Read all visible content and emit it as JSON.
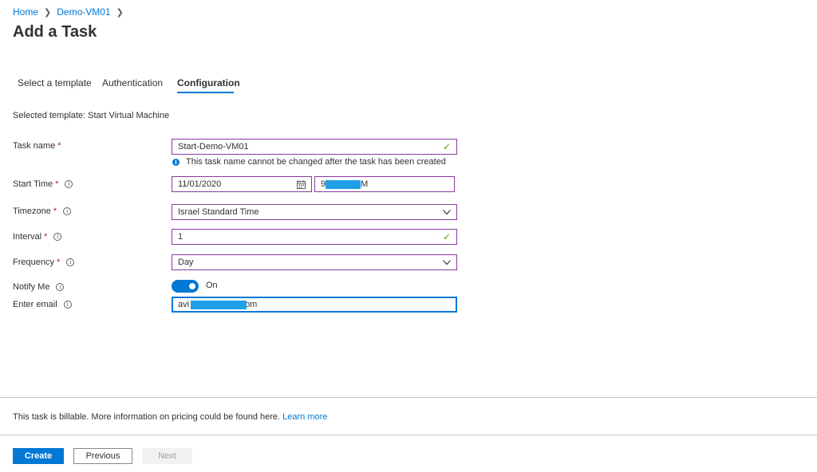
{
  "breadcrumb": {
    "home": "Home",
    "vm": "Demo-VM01"
  },
  "page_title": "Add a Task",
  "tabs": [
    {
      "label": "Select a template"
    },
    {
      "label": "Authentication"
    },
    {
      "label": "Configuration",
      "active": true
    }
  ],
  "selected_template": "Selected template: Start Virtual Machine",
  "form": {
    "task_name": {
      "label": "Task name",
      "value": "Start-Demo-VM01",
      "hint": "This task name cannot be changed after the task has been created"
    },
    "start_time": {
      "label": "Start Time",
      "date": "11/01/2020",
      "time_visible_start": "9",
      "time_visible_end": "M"
    },
    "timezone": {
      "label": "Timezone",
      "value": "Israel Standard Time"
    },
    "interval": {
      "label": "Interval",
      "value": "1"
    },
    "frequency": {
      "label": "Frequency",
      "value": "Day"
    },
    "notify_me": {
      "label": "Notify Me",
      "state": "On"
    },
    "email": {
      "label": "Enter email",
      "visible_start": "avi",
      "visible_end": "om"
    }
  },
  "footer": {
    "billing_text": "This task is billable. More information on pricing could be found here.",
    "learn_more": "Learn more"
  },
  "buttons": {
    "create": "Create",
    "previous": "Previous",
    "next": "Next"
  },
  "colors": {
    "accent": "#0078d4",
    "field_border": "#8a3a9e",
    "required": "#a4262c",
    "valid": "#57a300",
    "redaction": "#1e9fe6"
  }
}
